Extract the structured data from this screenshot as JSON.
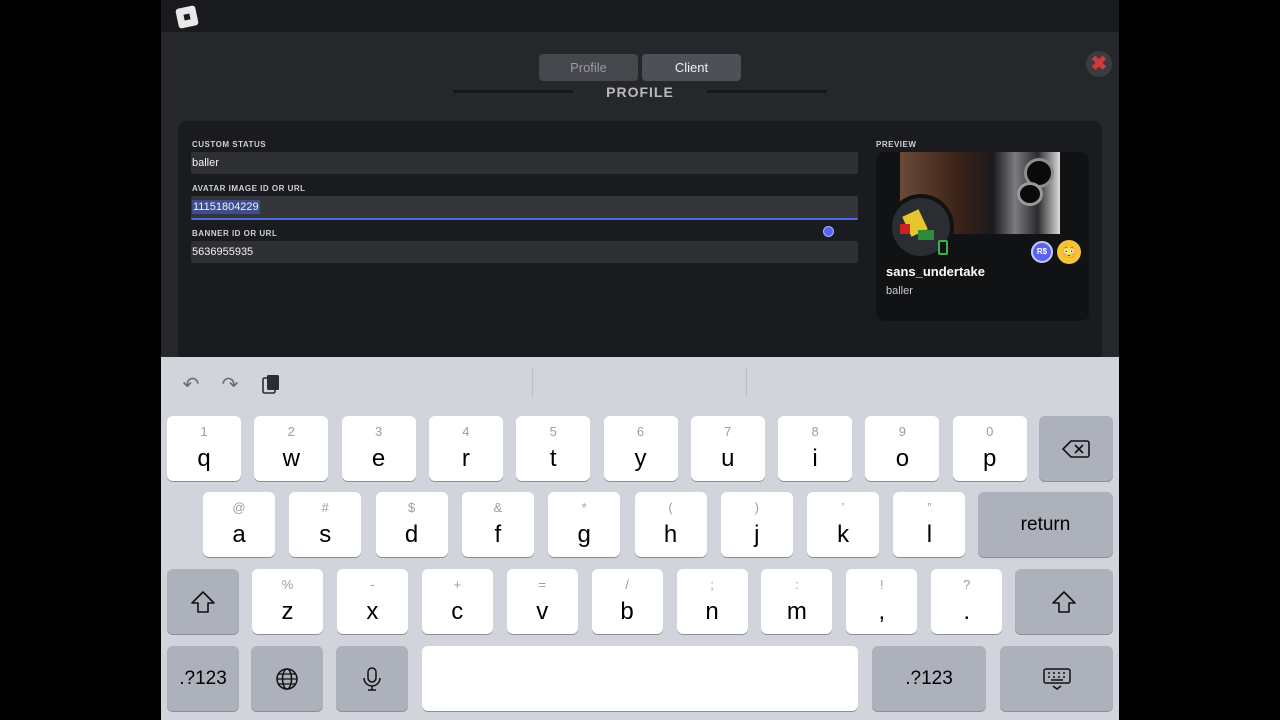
{
  "modal": {
    "tabs": [
      {
        "label": "Profile"
      },
      {
        "label": "Client"
      }
    ],
    "heading": "PROFILE",
    "close_glyph": "✖"
  },
  "form": {
    "custom_status": {
      "label": "CUSTOM STATUS",
      "value": "baller"
    },
    "avatar_image": {
      "label": "AVATAR IMAGE ID OR URL",
      "value": "11151804229"
    },
    "banner": {
      "label": "BANNER ID OR URL",
      "value": "5636955935"
    }
  },
  "preview": {
    "label": "PREVIEW",
    "username": "sans_undertake",
    "status": "baller",
    "robux_badge": "R$",
    "emoji_badge": "😳"
  },
  "keyboard": {
    "row1": [
      {
        "alt": "1",
        "main": "q"
      },
      {
        "alt": "2",
        "main": "w"
      },
      {
        "alt": "3",
        "main": "e"
      },
      {
        "alt": "4",
        "main": "r"
      },
      {
        "alt": "5",
        "main": "t"
      },
      {
        "alt": "6",
        "main": "y"
      },
      {
        "alt": "7",
        "main": "u"
      },
      {
        "alt": "8",
        "main": "i"
      },
      {
        "alt": "9",
        "main": "o"
      },
      {
        "alt": "0",
        "main": "p"
      }
    ],
    "row2": [
      {
        "alt": "@",
        "main": "a"
      },
      {
        "alt": "#",
        "main": "s"
      },
      {
        "alt": "$",
        "main": "d"
      },
      {
        "alt": "&",
        "main": "f"
      },
      {
        "alt": "*",
        "main": "g"
      },
      {
        "alt": "(",
        "main": "h"
      },
      {
        "alt": ")",
        "main": "j"
      },
      {
        "alt": "’",
        "main": "k"
      },
      {
        "alt": "”",
        "main": "l"
      }
    ],
    "row3": [
      {
        "alt": "%",
        "main": "z"
      },
      {
        "alt": "-",
        "main": "x"
      },
      {
        "alt": "+",
        "main": "c"
      },
      {
        "alt": "=",
        "main": "v"
      },
      {
        "alt": "/",
        "main": "b"
      },
      {
        "alt": ";",
        "main": "n"
      },
      {
        "alt": ":",
        "main": "m"
      },
      {
        "alt": "!",
        "main": ","
      },
      {
        "alt": "?",
        "main": "."
      }
    ],
    "return_label": "return",
    "numbers_label": ".?123"
  }
}
